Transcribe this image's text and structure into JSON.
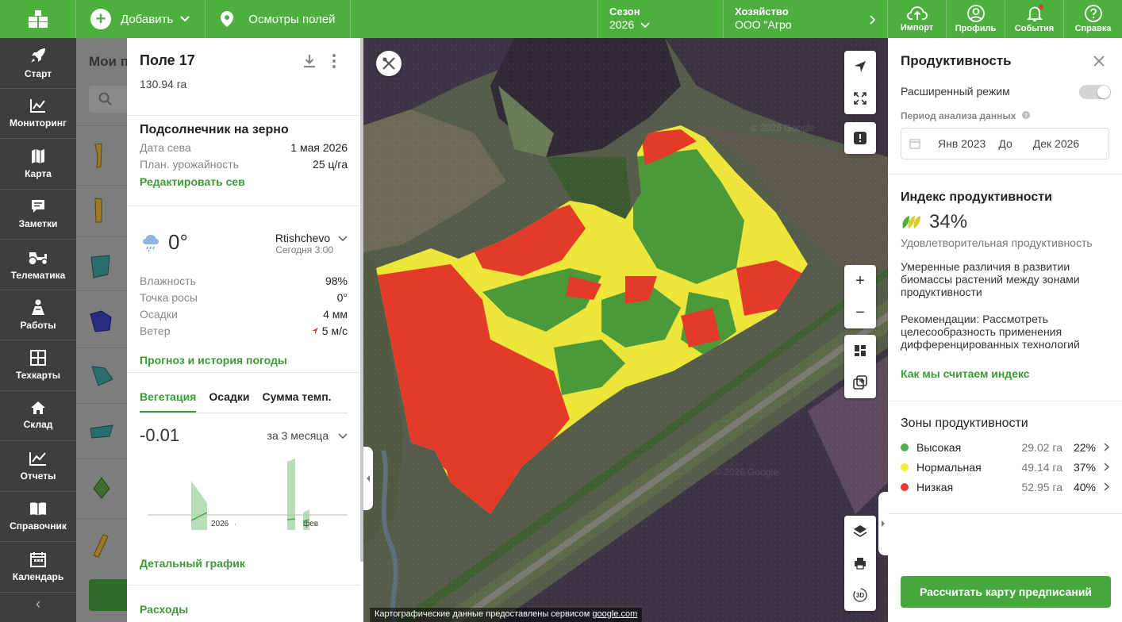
{
  "topbar": {
    "add_label": "Добавить",
    "inspections_label": "Осмотры полей",
    "season_title": "Сезон",
    "season_value": "2026",
    "farm_title": "Хозяйство",
    "farm_value": "ООО \"Агро",
    "import_label": "Импорт",
    "profile_label": "Профиль",
    "events_label": "События",
    "help_label": "Справка",
    "colors": {
      "brand": "#4caf3e"
    }
  },
  "leftnav": {
    "items": [
      {
        "label": "Старт",
        "icon": "rocket-icon"
      },
      {
        "label": "Мониторинг",
        "icon": "chart-icon"
      },
      {
        "label": "Карта",
        "icon": "map-icon"
      },
      {
        "label": "Заметки",
        "icon": "note-icon"
      },
      {
        "label": "Телематика",
        "icon": "tractor-icon"
      },
      {
        "label": "Работы",
        "icon": "worker-icon"
      },
      {
        "label": "Техкарты",
        "icon": "grid-icon"
      },
      {
        "label": "Склад",
        "icon": "home-icon"
      },
      {
        "label": "Отчеты",
        "icon": "report-icon"
      },
      {
        "label": "Справочник",
        "icon": "book-icon"
      },
      {
        "label": "Календарь",
        "icon": "calendar-icon"
      }
    ]
  },
  "fieldlist": {
    "title": "Мои п"
  },
  "field": {
    "name": "Поле 17",
    "area": "130.94 га",
    "crop": "Подсолнечник на зерно",
    "sow_date_label": "Дата сева",
    "sow_date_value": "1 мая 2026",
    "yield_label": "План. урожайность",
    "yield_value": "25 ц/га",
    "edit_sow_link": "Редактировать сев"
  },
  "weather": {
    "temp": "0°",
    "location": "Rtishchevo",
    "time": "Сегодня 3:00",
    "humidity_label": "Влажность",
    "humidity_value": "98%",
    "dew_label": "Точка росы",
    "dew_value": "0°",
    "precip_label": "Осадки",
    "precip_value": "4 мм",
    "wind_label": "Ветер",
    "wind_value": "5 м/с",
    "forecast_link": "Прогноз и история погоды"
  },
  "vegetation": {
    "tabs": [
      "Вегетация",
      "Осадки",
      "Сумма темп."
    ],
    "value": "-0.01",
    "period": "за 3 месяца",
    "tick_2026": "2026",
    "tick_feb": "фев",
    "detail_link": "Детальный график",
    "expenses_link": "Расходы"
  },
  "map": {
    "attribution_prefix": "Картографические данные предоставлены сервисом ",
    "attribution_link": "google.com",
    "watermark": "© 2026 Google",
    "zone_colors": {
      "high": "#4a9a3a",
      "normal": "#ece53a",
      "low": "#e33a2a"
    }
  },
  "productivity": {
    "title": "Продуктивность",
    "advanced_mode": "Расширенный режим",
    "period_label": "Период анализа данных",
    "period_from": "Янв 2023",
    "period_to_word": "До",
    "period_to": "Дек 2026",
    "index_title": "Индекс продуктивности",
    "index_value": "34%",
    "index_desc": "Удовлетворительная продуктивность",
    "description": "Умеренные различия в развитии биомассы растений между зонами продуктивности",
    "recommendation": "Рекомендации: Рассмотреть целесообразность применения дифференцированных технологий",
    "how_link": "Как мы считаем индекс",
    "zones_title": "Зоны продуктивности",
    "zones": [
      {
        "name": "Высокая",
        "area": "29.02 га",
        "pct": "22%",
        "color": "#4caf50"
      },
      {
        "name": "Нормальная",
        "area": "49.14 га",
        "pct": "37%",
        "color": "#f5ee3b"
      },
      {
        "name": "Низкая",
        "area": "52.95 га",
        "pct": "40%",
        "color": "#e53935"
      }
    ],
    "calc_button": "Рассчитать карту предписаний"
  }
}
